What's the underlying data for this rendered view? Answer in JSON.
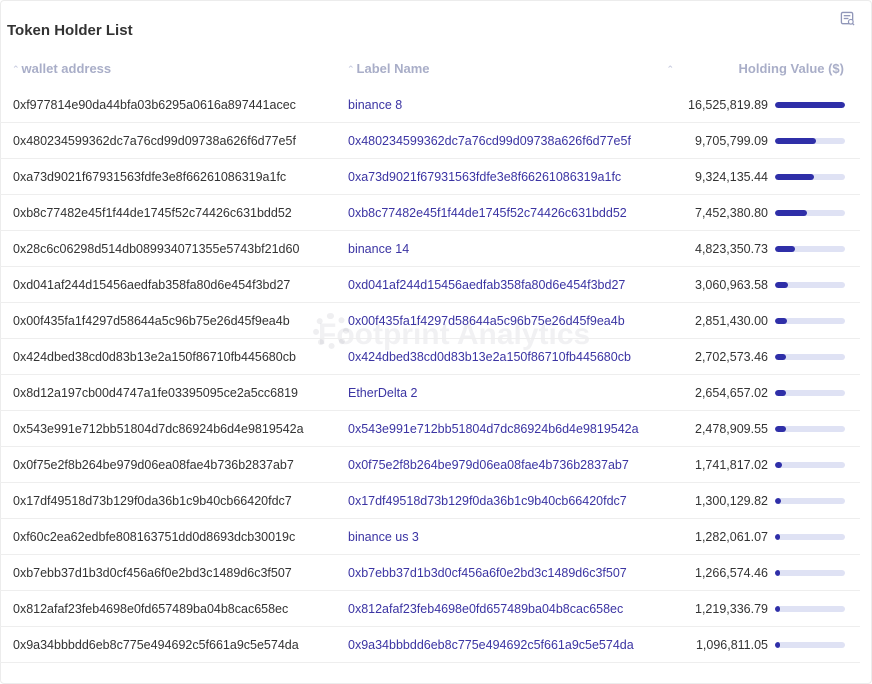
{
  "panel": {
    "title": "Token Holder List",
    "export_icon": "table-export-icon"
  },
  "table": {
    "columns": {
      "wallet": "wallet address",
      "label": "Label Name",
      "holding": "Holding Value ($)"
    },
    "rows": [
      {
        "wallet": "0xf977814e90da44bfa03b6295a0616a897441acec",
        "label": "binance 8",
        "value": "16,525,819.89",
        "fraction": 1.0
      },
      {
        "wallet": "0x480234599362dc7a76cd99d09738a626f6d77e5f",
        "label": "0x480234599362dc7a76cd99d09738a626f6d77e5f",
        "value": "9,705,799.09",
        "fraction": 0.587
      },
      {
        "wallet": "0xa73d9021f67931563fdfe3e8f66261086319a1fc",
        "label": "0xa73d9021f67931563fdfe3e8f66261086319a1fc",
        "value": "9,324,135.44",
        "fraction": 0.564
      },
      {
        "wallet": "0xb8c77482e45f1f44de1745f52c74426c631bdd52",
        "label": "0xb8c77482e45f1f44de1745f52c74426c631bdd52",
        "value": "7,452,380.80",
        "fraction": 0.451
      },
      {
        "wallet": "0x28c6c06298d514db089934071355e5743bf21d60",
        "label": "binance 14",
        "value": "4,823,350.73",
        "fraction": 0.292
      },
      {
        "wallet": "0xd041af244d15456aedfab358fa80d6e454f3bd27",
        "label": "0xd041af244d15456aedfab358fa80d6e454f3bd27",
        "value": "3,060,963.58",
        "fraction": 0.185
      },
      {
        "wallet": "0x00f435fa1f4297d58644a5c96b75e26d45f9ea4b",
        "label": "0x00f435fa1f4297d58644a5c96b75e26d45f9ea4b",
        "value": "2,851,430.00",
        "fraction": 0.173
      },
      {
        "wallet": "0x424dbed38cd0d83b13e2a150f86710fb445680cb",
        "label": "0x424dbed38cd0d83b13e2a150f86710fb445680cb",
        "value": "2,702,573.46",
        "fraction": 0.164
      },
      {
        "wallet": "0x8d12a197cb00d4747a1fe03395095ce2a5cc6819",
        "label": "EtherDelta 2",
        "value": "2,654,657.02",
        "fraction": 0.161
      },
      {
        "wallet": "0x543e991e712bb51804d7dc86924b6d4e9819542a",
        "label": "0x543e991e712bb51804d7dc86924b6d4e9819542a",
        "value": "2,478,909.55",
        "fraction": 0.15
      },
      {
        "wallet": "0x0f75e2f8b264be979d06ea08fae4b736b2837ab7",
        "label": "0x0f75e2f8b264be979d06ea08fae4b736b2837ab7",
        "value": "1,741,817.02",
        "fraction": 0.105
      },
      {
        "wallet": "0x17df49518d73b129f0da36b1c9b40cb66420fdc7",
        "label": "0x17df49518d73b129f0da36b1c9b40cb66420fdc7",
        "value": "1,300,129.82",
        "fraction": 0.079
      },
      {
        "wallet": "0xf60c2ea62edbfe808163751dd0d8693dcb30019c",
        "label": "binance us 3",
        "value": "1,282,061.07",
        "fraction": 0.078
      },
      {
        "wallet": "0xb7ebb37d1b3d0cf456a6f0e2bd3c1489d6c3f507",
        "label": "0xb7ebb37d1b3d0cf456a6f0e2bd3c1489d6c3f507",
        "value": "1,266,574.46",
        "fraction": 0.077
      },
      {
        "wallet": "0x812afaf23feb4698e0fd657489ba04b8cac658ec",
        "label": "0x812afaf23feb4698e0fd657489ba04b8cac658ec",
        "value": "1,219,336.79",
        "fraction": 0.074
      },
      {
        "wallet": "0x9a34bbbdd6eb8c775e494692c5f661a9c5e574da",
        "label": "0x9a34bbbdd6eb8c775e494692c5f661a9c5e574da",
        "value": "1,096,811.05",
        "fraction": 0.066
      }
    ]
  },
  "watermark": "Footprint Analytics",
  "colors": {
    "accent": "#2f2fa8",
    "bar_track": "#dfe2f4",
    "link": "#3b34a3",
    "header_text": "#a9aec8"
  }
}
